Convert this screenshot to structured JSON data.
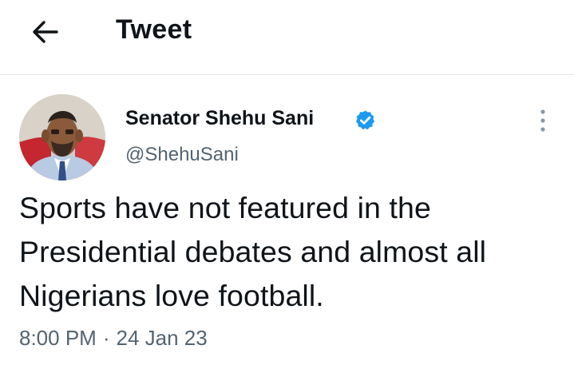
{
  "header": {
    "title": "Tweet",
    "back_icon": "arrow-left-icon"
  },
  "tweet": {
    "author_name": "Senator Shehu Sani",
    "handle": "@ShehuSani",
    "verified": true,
    "text": "Sports have not featured in the Presidential debates and almost all Nigerians love football.",
    "time": "8:00 PM",
    "separator": "·",
    "date": "24 Jan 23"
  },
  "colors": {
    "text": "#0f1419",
    "secondary": "#536471",
    "verified_badge": "#1d9bf0",
    "divider": "#e6e6e6"
  }
}
